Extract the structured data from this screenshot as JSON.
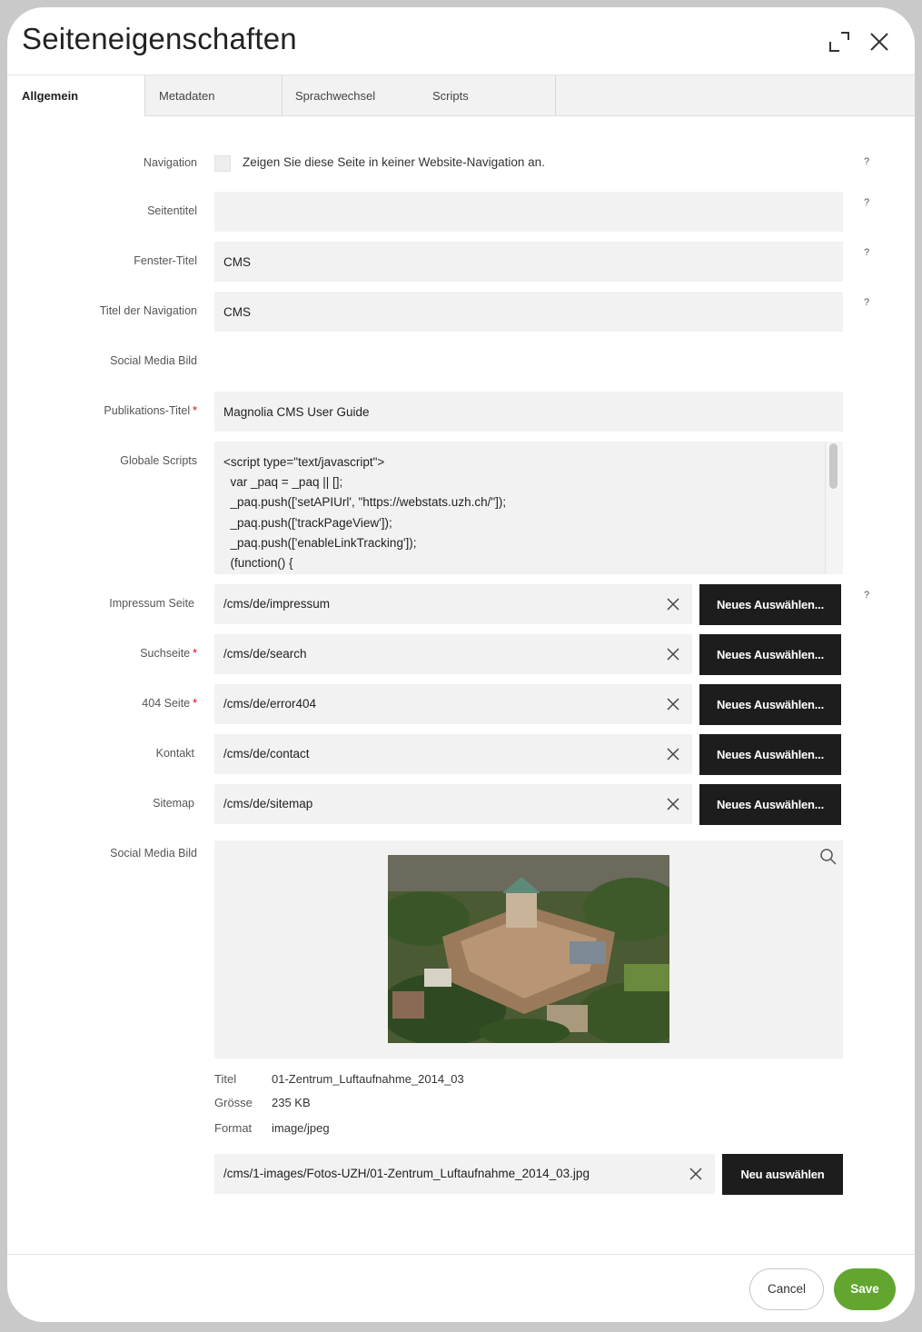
{
  "dialog": {
    "title": "Seiteneigenschaften",
    "icons": {
      "fullscreen": "fullscreen-icon",
      "close": "close-icon"
    }
  },
  "tabs": [
    {
      "label": "Allgemein",
      "active": true
    },
    {
      "label": "Metadaten",
      "active": false
    },
    {
      "label": "Sprachwechsel",
      "active": false
    },
    {
      "label": "Scripts",
      "active": false
    }
  ],
  "form": {
    "navigation": {
      "label": "Navigation",
      "checkbox_text": "Zeigen Sie diese Seite in keiner Website-Navigation an.",
      "checked": false,
      "help": "?"
    },
    "seitentitel": {
      "label": "Seitentitel",
      "value": "",
      "help": "?"
    },
    "fenster_titel": {
      "label": "Fenster-Titel",
      "value": "CMS",
      "help": "?"
    },
    "titel_navigation": {
      "label": "Titel der Navigation",
      "value": "CMS",
      "help": "?"
    },
    "social_media_bild_top": {
      "label": "Social Media Bild"
    },
    "publikations_titel": {
      "label": "Publikations-Titel",
      "required": "*",
      "value": "Magnolia CMS User Guide"
    },
    "globale_scripts": {
      "label": "Globale Scripts",
      "value": "<script type=\"text/javascript\">\n  var _paq = _paq || [];\n  _paq.push(['setAPIUrl', \"https://webstats.uzh.ch/\"]);\n  _paq.push(['trackPageView']);\n  _paq.push(['enableLinkTracking']);\n  (function() {"
    },
    "link_fields": [
      {
        "label": "Impressum Seite",
        "required": "",
        "value": "/cms/de/impressum",
        "button": "Neues Auswählen...",
        "help": "?"
      },
      {
        "label": "Suchseite",
        "required": "*",
        "value": "/cms/de/search",
        "button": "Neues Auswählen...",
        "help": ""
      },
      {
        "label": "404 Seite",
        "required": "*",
        "value": "/cms/de/error404",
        "button": "Neues Auswählen...",
        "help": ""
      },
      {
        "label": "Kontakt",
        "required": "",
        "value": "/cms/de/contact",
        "button": "Neues Auswählen...",
        "help": ""
      },
      {
        "label": "Sitemap",
        "required": "",
        "value": "/cms/de/sitemap",
        "button": "Neues Auswählen...",
        "help": ""
      }
    ],
    "social_media_bild": {
      "label": "Social Media Bild",
      "meta": [
        {
          "key": "Titel",
          "value": "01-Zentrum_Luftaufnahme_2014_03"
        },
        {
          "key": "Grösse",
          "value": "235 KB"
        },
        {
          "key": "Format",
          "value": "image/jpeg"
        }
      ],
      "path": "/cms/1-images/Fotos-UZH/01-Zentrum_Luftaufnahme_2014_03.jpg",
      "button": "Neu auswählen"
    }
  },
  "footer": {
    "cancel": "Cancel",
    "save": "Save"
  },
  "colors": {
    "save": "#62a62f",
    "dark_button": "#1d1d1d",
    "field_bg": "#f2f2f2",
    "required": "#e2001a"
  }
}
